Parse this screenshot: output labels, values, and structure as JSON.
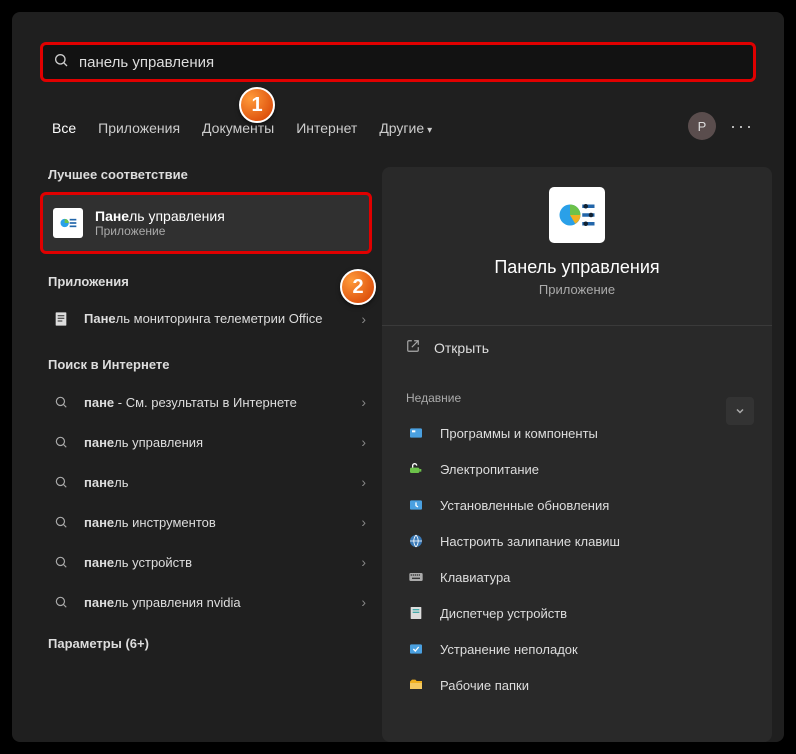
{
  "search": {
    "value": "панель управления"
  },
  "tabs": [
    "Все",
    "Приложения",
    "Документы",
    "Интернет",
    "Другие"
  ],
  "avatar_letter": "P",
  "sections": {
    "best_label": "Лучшее соответствие",
    "apps_label": "Приложения",
    "web_label": "Поиск в Интернете",
    "params_label": "Параметры (6+)"
  },
  "best": {
    "title_bold": "Пане",
    "title_rest": "ль управления",
    "sub": "Приложение"
  },
  "apps": [
    {
      "title_bold": "Пане",
      "title_rest": "ль мониторинга телеметрии Office"
    }
  ],
  "web": [
    {
      "bold": "пане",
      "rest": " - См. результаты в Интернете"
    },
    {
      "bold": "пане",
      "rest": "ль управления"
    },
    {
      "bold": "пане",
      "rest": "ль"
    },
    {
      "bold": "пане",
      "rest": "ль инструментов"
    },
    {
      "bold": "пане",
      "rest": "ль устройств"
    },
    {
      "bold": "пане",
      "rest": "ль управления nvidia"
    }
  ],
  "right": {
    "title": "Панель управления",
    "sub": "Приложение",
    "open": "Открыть",
    "recent_label": "Недавние",
    "recent": [
      "Программы и компоненты",
      "Электропитание",
      "Установленные обновления",
      "Настроить залипание клавиш",
      "Клавиатура",
      "Диспетчер устройств",
      "Устранение неполадок",
      "Рабочие папки"
    ]
  },
  "annotations": {
    "1": "1",
    "2": "2"
  }
}
